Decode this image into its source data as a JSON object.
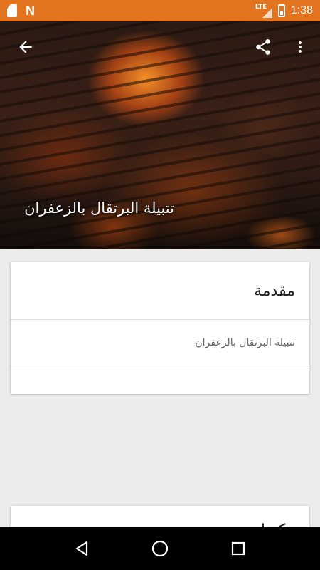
{
  "status_bar": {
    "time": "1:38",
    "network": "LTE",
    "left_icons": [
      "sd-card-icon",
      "n-icon"
    ],
    "right_icons": [
      "signal-icon",
      "battery-icon"
    ]
  },
  "hero": {
    "title": "تتبيلة البرتقال بالزعفران",
    "actions": [
      "back-arrow-icon",
      "share-icon",
      "more-vert-icon"
    ]
  },
  "card": {
    "title": "مقدمة",
    "body": "تتبيلة البرتقال بالزعفران",
    "footer": ""
  },
  "card2": {
    "title": "مكونات"
  },
  "nav_bar": {
    "buttons": [
      "back-icon",
      "home-icon",
      "recents-icon"
    ]
  },
  "colors": {
    "status_bar": "#e2741f",
    "background": "#ececec",
    "card": "#ffffff",
    "nav_bar": "#000000"
  }
}
